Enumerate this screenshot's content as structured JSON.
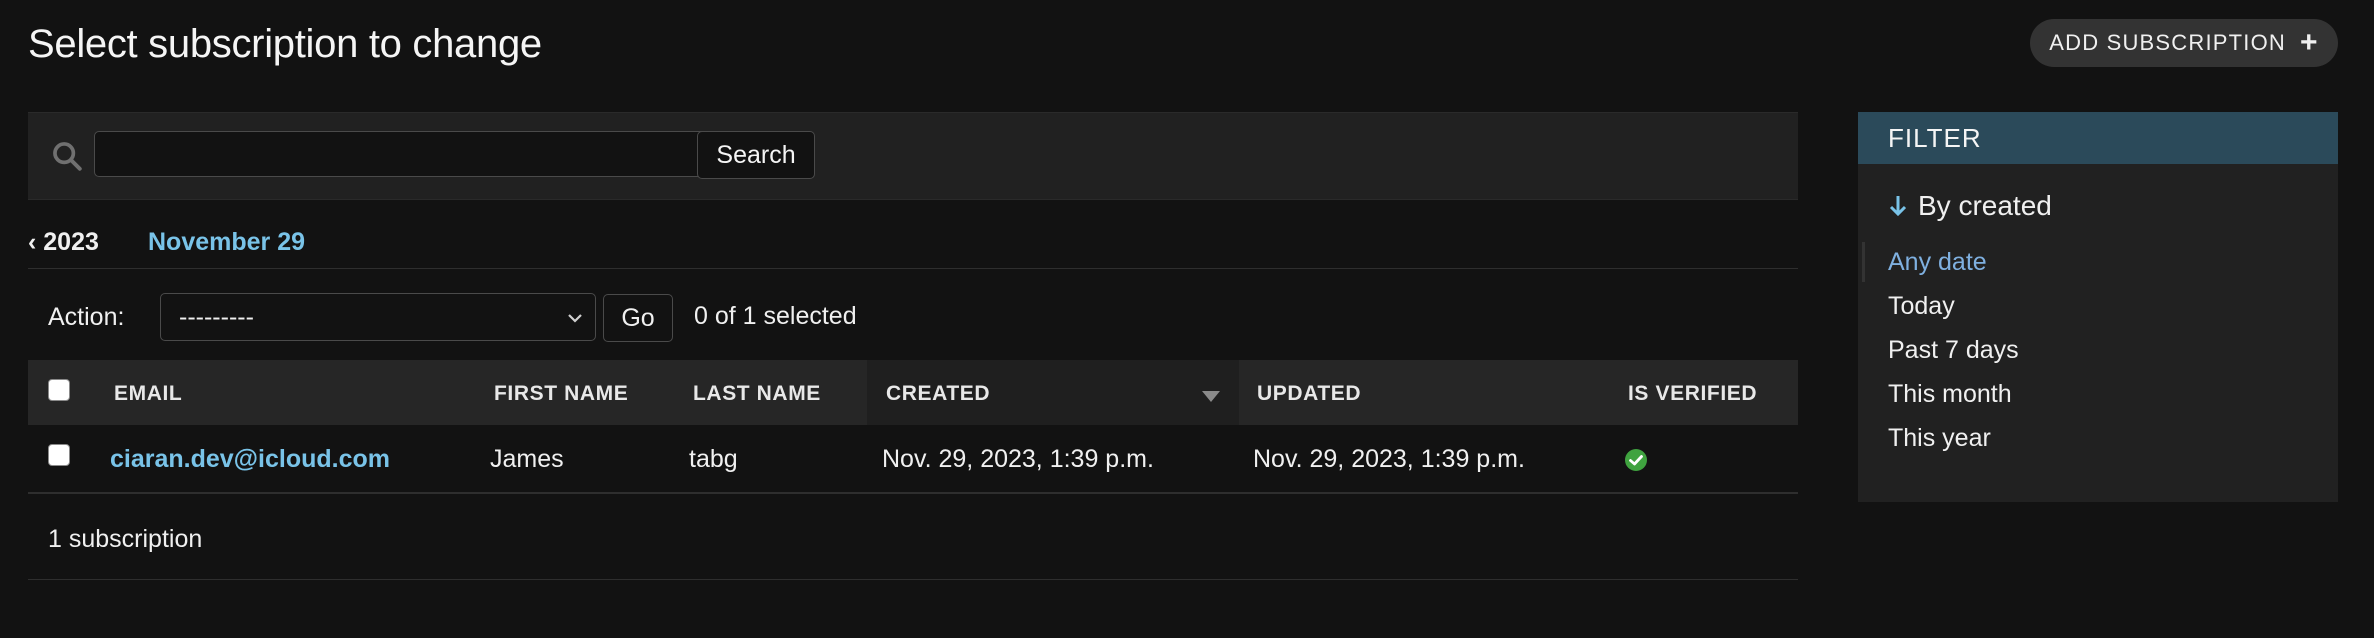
{
  "header": {
    "title": "Select subscription to change",
    "add_label": "ADD SUBSCRIPTION",
    "add_icon": "plus-icon"
  },
  "search": {
    "value": "",
    "placeholder": "",
    "button_label": "Search",
    "icon": "search-icon"
  },
  "date_hierarchy": {
    "back_label": "‹ 2023",
    "current": "November 29"
  },
  "actions": {
    "label": "Action:",
    "selected_option": "---------",
    "go_label": "Go",
    "selected_count": "0 of 1 selected"
  },
  "table": {
    "columns": [
      "EMAIL",
      "FIRST NAME",
      "LAST NAME",
      "CREATED",
      "UPDATED",
      "IS VERIFIED"
    ],
    "sorted_column": "CREATED",
    "sort_direction": "descending",
    "rows": [
      {
        "email": "ciaran.dev@icloud.com",
        "first_name": "James",
        "last_name": "tabg",
        "created": "Nov. 29, 2023, 1:39 p.m.",
        "updated": "Nov. 29, 2023, 1:39 p.m.",
        "is_verified": true
      }
    ],
    "count_label": "1 subscription"
  },
  "filter": {
    "header": "FILTER",
    "title": "By created",
    "options": [
      "Any date",
      "Today",
      "Past 7 days",
      "This month",
      "This year"
    ],
    "selected": "Any date"
  },
  "colors": {
    "background": "#121212",
    "link": "#79c3e8",
    "filter_header": "#2b4a5a",
    "verified": "#3fa33f"
  }
}
